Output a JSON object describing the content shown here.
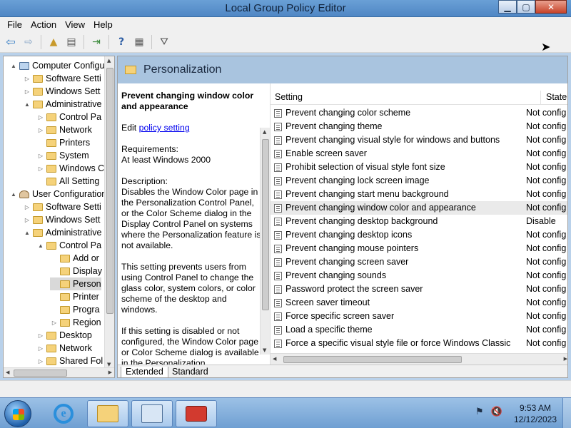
{
  "window": {
    "title": "Local Group Policy Editor",
    "minimize": "▁",
    "maximize": "▢",
    "close": "✕"
  },
  "menu": [
    "File",
    "Action",
    "View",
    "Help"
  ],
  "toolbar": [
    "back-arrow-icon",
    "forward-arrow-icon",
    "up-folder-icon",
    "show-hide-tree-icon",
    "export-list-icon",
    "help-icon",
    "properties-icon",
    "filter-icon"
  ],
  "tree": [
    {
      "label": "Computer Configu",
      "depth": 0,
      "expander": "▲",
      "icon": "computer-icon"
    },
    {
      "label": "Software Setti",
      "depth": 1,
      "expander": "▷",
      "icon": "folder-icon"
    },
    {
      "label": "Windows Sett",
      "depth": 1,
      "expander": "▷",
      "icon": "folder-icon"
    },
    {
      "label": "Administrative",
      "depth": 1,
      "expander": "▲",
      "icon": "folder-icon"
    },
    {
      "label": "Control Pa",
      "depth": 2,
      "expander": "▷",
      "icon": "folder-icon"
    },
    {
      "label": "Network",
      "depth": 2,
      "expander": "▷",
      "icon": "folder-icon"
    },
    {
      "label": "Printers",
      "depth": 2,
      "expander": "",
      "icon": "folder-icon"
    },
    {
      "label": "System",
      "depth": 2,
      "expander": "▷",
      "icon": "folder-icon"
    },
    {
      "label": "Windows C",
      "depth": 2,
      "expander": "▷",
      "icon": "folder-icon"
    },
    {
      "label": "All Setting",
      "depth": 2,
      "expander": "",
      "icon": "settings-icon"
    },
    {
      "label": "User Configuration",
      "depth": 0,
      "expander": "▲",
      "icon": "user-icon"
    },
    {
      "label": "Software Setti",
      "depth": 1,
      "expander": "▷",
      "icon": "folder-icon"
    },
    {
      "label": "Windows Sett",
      "depth": 1,
      "expander": "▷",
      "icon": "folder-icon"
    },
    {
      "label": "Administrative",
      "depth": 1,
      "expander": "▲",
      "icon": "folder-icon"
    },
    {
      "label": "Control Pa",
      "depth": 2,
      "expander": "▲",
      "icon": "folder-icon"
    },
    {
      "label": "Add or",
      "depth": 3,
      "expander": "",
      "icon": "folder-icon"
    },
    {
      "label": "Display",
      "depth": 3,
      "expander": "",
      "icon": "folder-icon"
    },
    {
      "label": "Person",
      "depth": 3,
      "expander": "",
      "icon": "folder-icon",
      "selected": true
    },
    {
      "label": "Printer",
      "depth": 3,
      "expander": "",
      "icon": "folder-icon"
    },
    {
      "label": "Progra",
      "depth": 3,
      "expander": "",
      "icon": "folder-icon"
    },
    {
      "label": "Region",
      "depth": 3,
      "expander": "▷",
      "icon": "folder-icon"
    },
    {
      "label": "Desktop",
      "depth": 2,
      "expander": "▷",
      "icon": "folder-icon"
    },
    {
      "label": "Network",
      "depth": 2,
      "expander": "▷",
      "icon": "folder-icon"
    },
    {
      "label": "Shared Fol",
      "depth": 2,
      "expander": "▷",
      "icon": "folder-icon"
    }
  ],
  "section": {
    "title": "Personalization"
  },
  "description": {
    "title": "Prevent changing window color and appearance",
    "edit_prefix": "Edit ",
    "edit_link": "policy setting",
    "requirements_label": "Requirements:",
    "requirements_value": "At least Windows 2000",
    "description_label": "Description:",
    "paragraph1": "Disables the Window Color page in the Personalization Control Panel, or the Color Scheme dialog in the Display Control Panel on systems where the Personalization feature is not available.",
    "paragraph2": "This setting prevents users from using Control Panel to change the glass color, system colors, or color scheme of the desktop and windows.",
    "paragraph3": "If this setting is disabled or not configured, the Window Color page or Color Scheme dialog is available in the Personalization"
  },
  "list": {
    "columns": {
      "setting": "Setting",
      "state": "State"
    },
    "rows": [
      {
        "name": "Prevent changing color scheme",
        "state": "Not config"
      },
      {
        "name": "Prevent changing theme",
        "state": "Not config"
      },
      {
        "name": "Prevent changing visual style for windows and buttons",
        "state": "Not config"
      },
      {
        "name": "Enable screen saver",
        "state": "Not config"
      },
      {
        "name": "Prohibit selection of visual style font size",
        "state": "Not config"
      },
      {
        "name": "Prevent changing lock screen image",
        "state": "Not config"
      },
      {
        "name": "Prevent changing start menu background",
        "state": "Not config"
      },
      {
        "name": "Prevent changing window color and appearance",
        "state": "Not config",
        "highlighted": true
      },
      {
        "name": "Prevent changing desktop background",
        "state": "Disable"
      },
      {
        "name": "Prevent changing desktop icons",
        "state": "Not config"
      },
      {
        "name": "Prevent changing mouse pointers",
        "state": "Not config"
      },
      {
        "name": "Prevent changing screen saver",
        "state": "Not config"
      },
      {
        "name": "Prevent changing sounds",
        "state": "Not config"
      },
      {
        "name": "Password protect the screen saver",
        "state": "Not config"
      },
      {
        "name": "Screen saver timeout",
        "state": "Not config"
      },
      {
        "name": "Force specific screen saver",
        "state": "Not config"
      },
      {
        "name": "Load a specific theme",
        "state": "Not config"
      },
      {
        "name": "Force a specific visual style file or force Windows Classic",
        "state": "Not config"
      }
    ]
  },
  "tabs": {
    "extended": "Extended",
    "standard": "Standard"
  },
  "taskbar": {
    "time": "9:53 AM",
    "date": "12/12/2023",
    "ie_glyph": "e"
  }
}
